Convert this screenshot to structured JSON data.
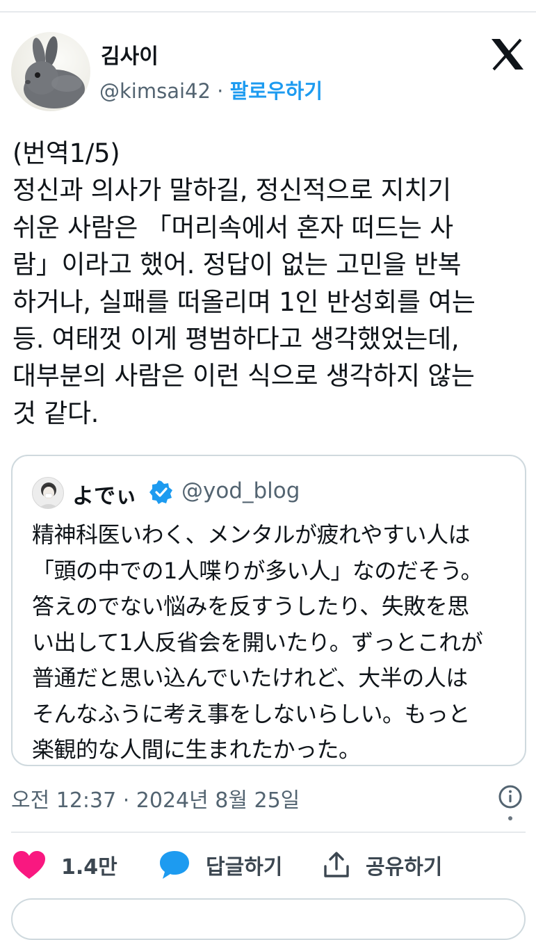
{
  "author": {
    "name": "김사이",
    "handle": "@kimsai42",
    "separator": "·",
    "follow_label": "팔로우하기"
  },
  "tweet": {
    "text": "(번역1/5)\n정신과 의사가 말하길, 정신적으로 지치기\n쉬운 사람은 「머리속에서 혼자 떠드는 사\n람」이라고 했어. 정답이 없는 고민을 반복\n하거나, 실패를 떠올리며 1인 반성회를 여는\n등. 여태껏 이게 평범하다고 생각했었는데,\n대부분의 사람은 이런 식으로 생각하지 않는\n것 같다."
  },
  "quote": {
    "name": "よでぃ",
    "handle": "@yod_blog",
    "text": "精神科医いわく、メンタルが疲れやすい人は\n「頭の中での1人喋りが多い人」なのだそう。\n答えのでない悩みを反すうしたり、失敗を思\nい出して1人反省会を開いたり。ずっとこれが\n普通だと思い込んでいたけれど、大半の人は\nそんなふうに考え事をしないらしい。もっと\n楽観的な人間に生まれたかった。"
  },
  "timestamp": "오전 12:37 · 2024년 8월 25일",
  "actions": {
    "like_count": "1.4만",
    "reply_label": "답글하기",
    "share_label": "공유하기"
  },
  "colors": {
    "accent": "#1d9bf0",
    "like": "#f91880",
    "text": "#0f1419",
    "muted": "#536471",
    "border": "#cfd9de"
  },
  "icons": {
    "brand": "x-logo-icon",
    "verified": "verified-badge-icon",
    "info": "info-icon",
    "like": "heart-icon",
    "reply": "reply-bubble-icon",
    "share": "share-icon"
  }
}
